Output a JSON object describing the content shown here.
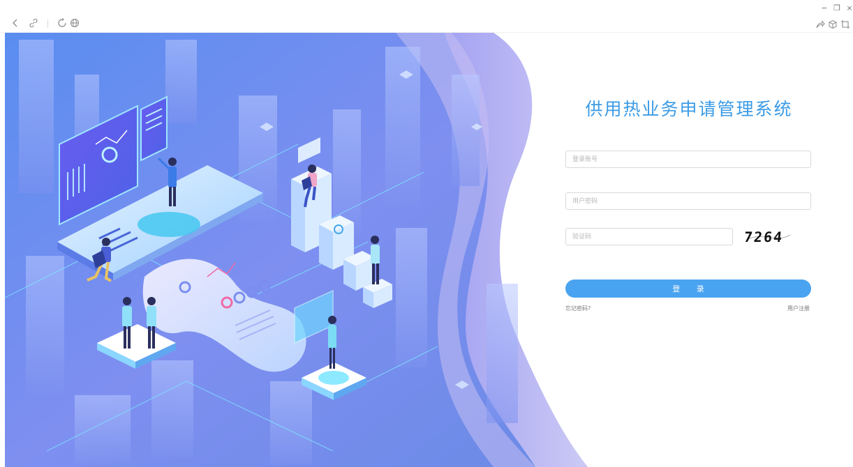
{
  "toolbar": {
    "back_icon": "chevron-left-icon",
    "link_icon": "link-icon",
    "refresh_icon": "refresh-icon",
    "globe_icon": "globe-icon",
    "share_icon": "share-icon",
    "cube_icon": "cube-icon",
    "screenshot_icon": "screenshot-icon",
    "minimize_label": "−",
    "restore_label": "❐",
    "close_label": "×"
  },
  "login": {
    "title": "供用热业务申请管理系统",
    "account_placeholder": "登录账号",
    "password_placeholder": "用户密码",
    "captcha_placeholder": "验证码",
    "captcha_text": "7264",
    "login_label": "登 录",
    "forgot_label": "忘记密码?",
    "register_label": "用户注册"
  },
  "colors": {
    "accent": "#4aa3f0",
    "title": "#3b9be6",
    "illustration_base": "#7f93f0"
  }
}
